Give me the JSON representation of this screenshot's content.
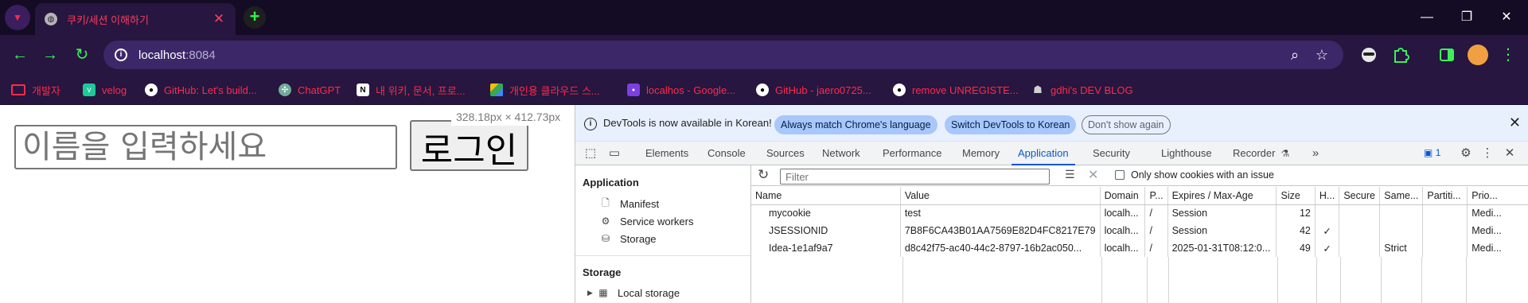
{
  "browser": {
    "tab": {
      "title": "쿠키/세션 이해하기",
      "close": "✕"
    },
    "new_tab": "+",
    "window_controls": {
      "minimize": "—",
      "restore": "❐",
      "close": "✕"
    },
    "address": {
      "host": "localhost",
      "port": ":8084"
    },
    "bookmarks": [
      {
        "label": "개발자",
        "icon": "folder-icon",
        "color": "#ff2a4a"
      },
      {
        "label": "velog",
        "icon": "velog-icon",
        "color": "#20c997"
      },
      {
        "label": "GitHub: Let's build...",
        "icon": "github-icon",
        "color": "#ffffff"
      },
      {
        "label": "ChatGPT",
        "icon": "chatgpt-icon",
        "color": "#74aa9c"
      },
      {
        "label": "내 위키, 문서, 프로...",
        "icon": "notion-icon",
        "color": "#ffffff"
      },
      {
        "label": "개인용 클라우드 스...",
        "icon": "google-drive-icon",
        "color": "#34a853"
      },
      {
        "label": "localhos - Google...",
        "icon": "site-icon",
        "color": "#7b3fe4"
      },
      {
        "label": "GitHub - jaero0725...",
        "icon": "github-icon",
        "color": "#ffffff"
      },
      {
        "label": "remove UNREGISTE...",
        "icon": "github-icon",
        "color": "#ffffff"
      },
      {
        "label": "gdhi's DEV BLOG",
        "icon": "blog-icon",
        "color": "#d0d0d0"
      }
    ]
  },
  "page": {
    "name_placeholder": "이름을 입력하세요",
    "login_label": "로그인",
    "dimension_tooltip": "328.18px × 412.73px"
  },
  "devtools": {
    "infobar": {
      "text": "DevTools is now available in Korean!",
      "btn_match": "Always match Chrome's language",
      "btn_switch": "Switch DevTools to Korean",
      "btn_dismiss": "Don't show again"
    },
    "tabs": [
      "Elements",
      "Console",
      "Sources",
      "Network",
      "Performance",
      "Memory",
      "Application",
      "Security",
      "Lighthouse",
      "Recorder"
    ],
    "active_tab": "Application",
    "issues_count": "1",
    "sidebar": {
      "application_header": "Application",
      "app_items": [
        "Manifest",
        "Service workers",
        "Storage"
      ],
      "storage_header": "Storage",
      "storage_items": [
        "Local storage"
      ]
    },
    "filter": {
      "placeholder": "Filter",
      "only_issue_label": "Only show cookies with an issue"
    },
    "cookie_columns": [
      "Name",
      "Value",
      "Domain",
      "P...",
      "Expires / Max-Age",
      "Size",
      "H...",
      "Secure",
      "Same...",
      "Partiti...",
      "Prio..."
    ],
    "cookies": [
      {
        "name": "mycookie",
        "value": "test",
        "domain": "localh...",
        "path": "/",
        "expires": "Session",
        "size": "12",
        "httponly": "",
        "secure": "",
        "samesite": "",
        "partition": "",
        "priority": "Medi..."
      },
      {
        "name": "JSESSIONID",
        "value": "7B8F6CA43B01AA7569E82D4FC8217E79",
        "domain": "localh...",
        "path": "/",
        "expires": "Session",
        "size": "42",
        "httponly": "✓",
        "secure": "",
        "samesite": "",
        "partition": "",
        "priority": "Medi..."
      },
      {
        "name": "Idea-1e1af9a7",
        "value": "d8c42f75-ac40-44c2-8797-16b2ac050...",
        "domain": "localh...",
        "path": "/",
        "expires": "2025-01-31T08:12:0...",
        "size": "49",
        "httponly": "✓",
        "secure": "",
        "samesite": "Strict",
        "partition": "",
        "priority": "Medi..."
      }
    ]
  },
  "colors": {
    "chrome_dark": "#140c24",
    "chrome_purple": "#261640",
    "accent_red": "#ff2a4a",
    "accent_green": "#3cf05a",
    "devtools_blue": "#0b57d0"
  }
}
